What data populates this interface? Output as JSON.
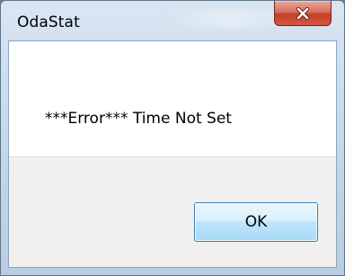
{
  "window": {
    "title": "OdaStat"
  },
  "dialog": {
    "message": "***Error*** Time Not Set",
    "ok_label": "OK"
  },
  "icons": {
    "close": "close-icon"
  },
  "colors": {
    "close_button": "#c4402b",
    "ok_button_border": "#3c7fb1",
    "button_area": "#f0f0f0"
  }
}
